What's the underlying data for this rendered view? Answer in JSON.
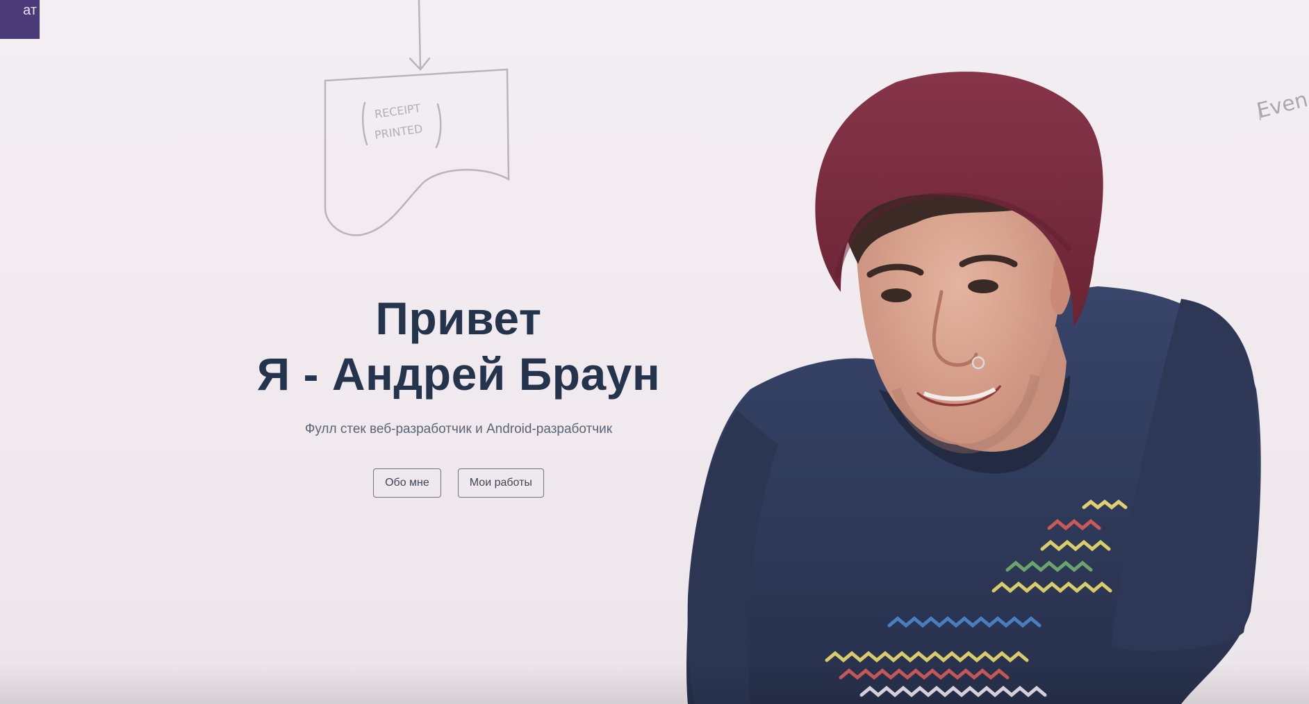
{
  "corner_tab": {
    "label": "ат",
    "color": "#4a3a78"
  },
  "hero": {
    "title_line1": "Привет",
    "title_line2": "Я - Андрей Браун",
    "subtitle": "Фулл стек веб-разработчик и Android-разработчик",
    "title_color": "#25344d",
    "subtitle_color": "#5b6475"
  },
  "buttons": {
    "about_label": "Обо мне",
    "works_label": "Мои работы"
  },
  "background": {
    "sketch_box_text_line1": "RECEIPT",
    "sketch_box_text_line2": "PRINTED",
    "sketch_corner_text": "Even"
  },
  "colors": {
    "beanie": "#7a2b3c",
    "shirt": "#323d5e",
    "skin": "#d9a48f",
    "hair": "#3b2a25"
  }
}
